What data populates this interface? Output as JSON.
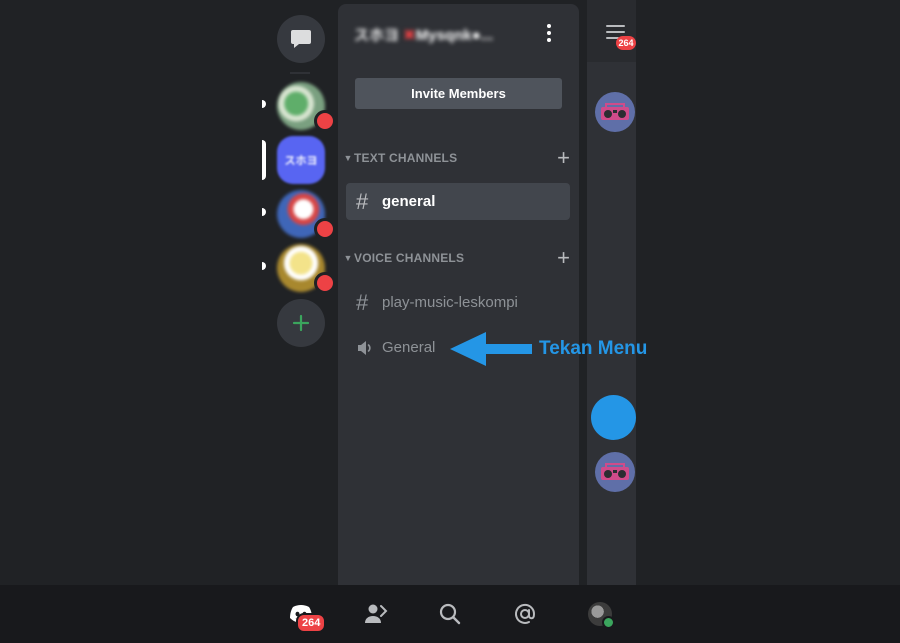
{
  "rail": {
    "dm_icon": "chat-bubble-icon",
    "server2_initials": "スホヨ",
    "add_icon": "plus-icon"
  },
  "server": {
    "name_prefix": "スホヨ ",
    "name_mark": "✖",
    "name_rest": "Mysqnk●...",
    "invite_label": "Invite Members"
  },
  "categories": {
    "text": {
      "label": "TEXT CHANNELS"
    },
    "voice": {
      "label": "VOICE CHANNELS"
    }
  },
  "channels": [
    {
      "name": "general",
      "type": "text",
      "active": true
    },
    {
      "name": "play-music-leskompi",
      "type": "text",
      "active": false
    },
    {
      "name": "General",
      "type": "voice",
      "active": false
    }
  ],
  "members": {
    "badge_count": "264"
  },
  "annotation": {
    "text": "Tekan Menu",
    "color": "#2496e6"
  },
  "bottom_nav": {
    "home_badge": "264"
  },
  "colors": {
    "background": "#202225",
    "panel": "#2f3136",
    "accent_red": "#ed4245",
    "accent_green": "#3ba55d",
    "blurple": "#5865f2"
  }
}
